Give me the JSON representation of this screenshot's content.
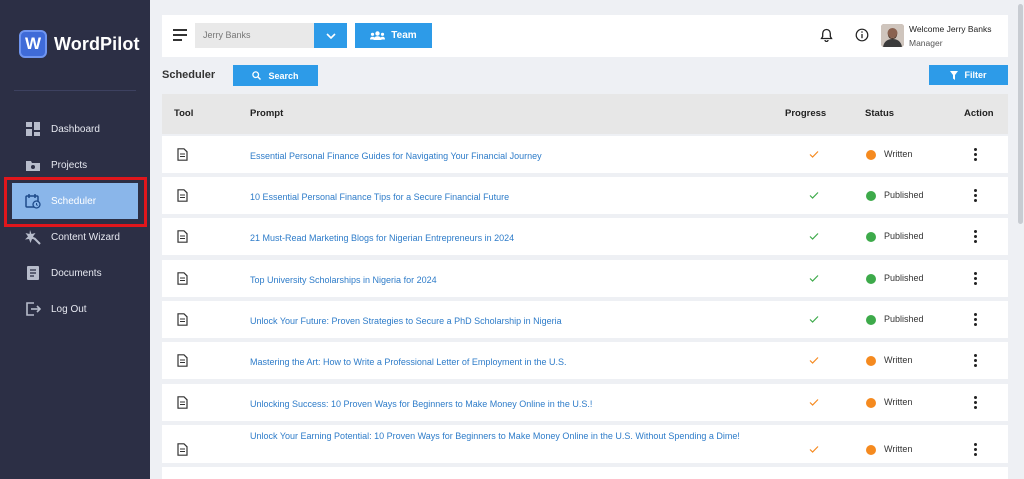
{
  "brand": {
    "logo_letter": "W",
    "name": "WordPilot"
  },
  "sidebar": {
    "items": [
      {
        "label": "Dashboard",
        "icon": "dashboard-icon"
      },
      {
        "label": "Projects",
        "icon": "projects-icon"
      },
      {
        "label": "Scheduler",
        "icon": "calendar-clock-icon",
        "active": true
      },
      {
        "label": "Content Wizard",
        "icon": "wizard-icon"
      },
      {
        "label": "Documents",
        "icon": "document-icon"
      },
      {
        "label": "Log Out",
        "icon": "logout-icon"
      }
    ]
  },
  "topbar": {
    "selected_user": "Jerry Banks",
    "team_label": "Team",
    "welcome": "Welcome Jerry Banks",
    "role": "Manager"
  },
  "page": {
    "title": "Scheduler",
    "search_label": "Search",
    "filter_label": "Filter"
  },
  "table": {
    "headers": {
      "tool": "Tool",
      "prompt": "Prompt",
      "progress": "Progress",
      "status": "Status",
      "action": "Action"
    },
    "rows": [
      {
        "prompt": "Essential Personal Finance Guides for Navigating Your Financial Journey",
        "status": "Written"
      },
      {
        "prompt": "10 Essential Personal Finance Tips for a Secure Financial Future",
        "status": "Published"
      },
      {
        "prompt": "21 Must-Read Marketing Blogs for Nigerian Entrepreneurs in 2024",
        "status": "Published"
      },
      {
        "prompt": "Top University Scholarships in Nigeria for 2024",
        "status": "Published"
      },
      {
        "prompt": "Unlock Your Future: Proven Strategies to Secure a PhD Scholarship in Nigeria",
        "status": "Published"
      },
      {
        "prompt": "Mastering the Art: How to Write a Professional Letter of Employment in the U.S.",
        "status": "Written"
      },
      {
        "prompt": "Unlocking Success: 10 Proven Ways for Beginners to Make Money Online in the U.S.!",
        "status": "Written"
      },
      {
        "prompt": "Unlock Your Earning Potential: 10 Proven Ways for Beginners to Make Money Online in the U.S. Without Spending a Dime!",
        "status": "Written"
      }
    ]
  },
  "colors": {
    "accent": "#2d9be8",
    "sidebar_bg": "#2c2f45",
    "written": "#f58a1f",
    "published": "#3daa4a",
    "link": "#2e7cc9",
    "highlight": "#e0161c"
  }
}
